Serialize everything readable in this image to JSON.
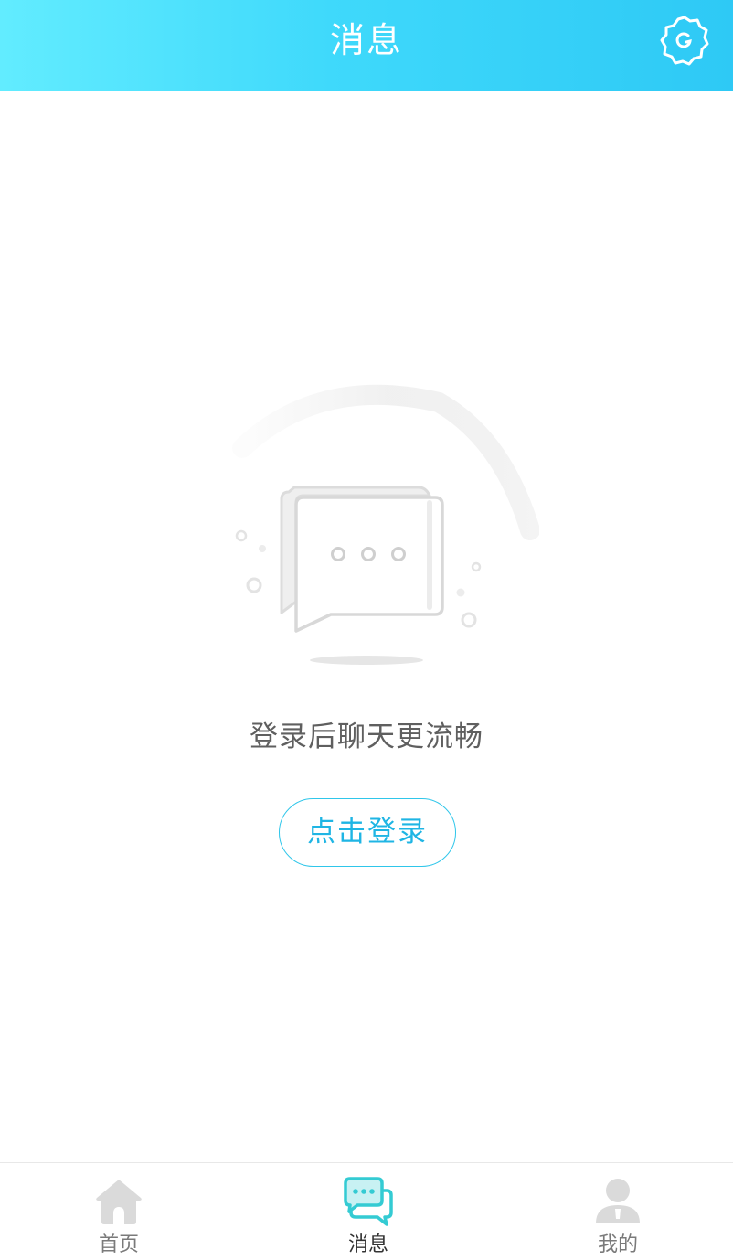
{
  "header": {
    "title": "消息",
    "settings_icon": "gear-icon"
  },
  "empty_state": {
    "illustration_icon": "chat-bubbles-icon",
    "message": "登录后聊天更流畅",
    "login_button": "点击登录"
  },
  "tabbar": {
    "active": "messages",
    "items": [
      {
        "key": "home",
        "label": "首页",
        "icon": "home-icon"
      },
      {
        "key": "messages",
        "label": "消息",
        "icon": "chat-icon"
      },
      {
        "key": "mine",
        "label": "我的",
        "icon": "user-icon"
      }
    ]
  },
  "colors": {
    "header_gradient_start": "#62ecff",
    "header_gradient_end": "#2ec9f5",
    "accent": "#2fc6ea",
    "active_tab_icon": "#34cbd3",
    "inactive_tab_icon": "#d9d9d9"
  }
}
